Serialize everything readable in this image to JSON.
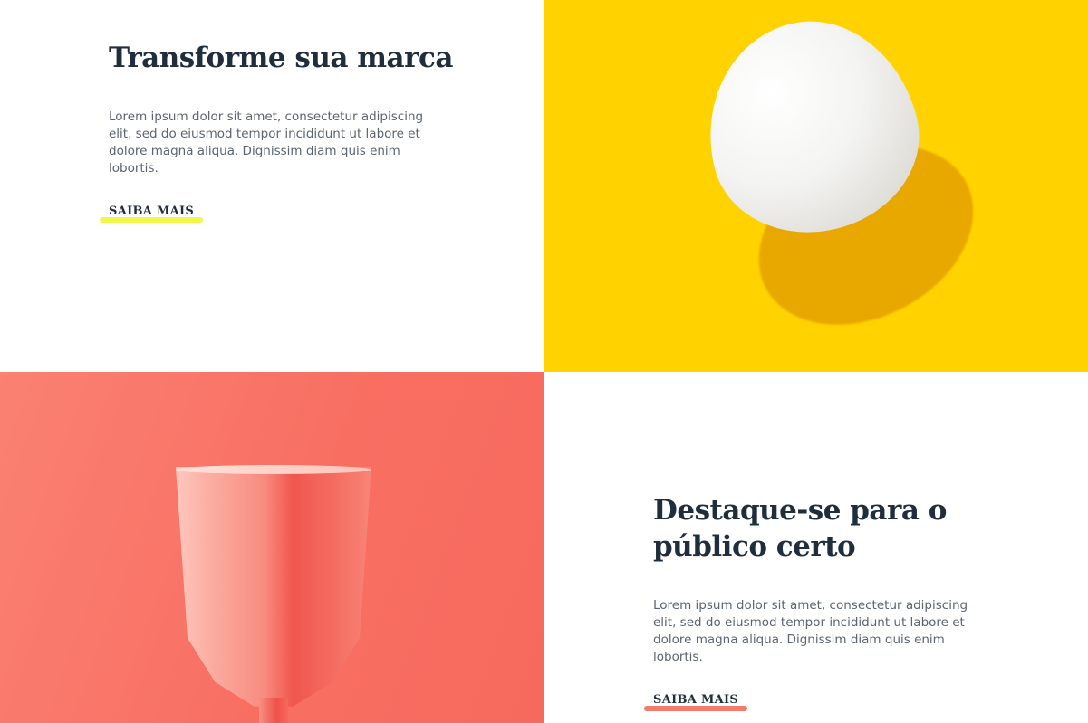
{
  "section_1": {
    "heading": "Transforme sua marca",
    "body": "Lorem ipsum dolor sit amet, consectetur adipiscing elit, sed do eiusmod tempor incididunt ut labore et dolore magna aliqua. Dignissim diam quis enim lobortis.",
    "cta_label": "SAIBA MAIS",
    "cta_underline_color": "#f4f64a",
    "image": {
      "subject": "egg-image",
      "background_color": "#ffd200"
    }
  },
  "section_2": {
    "heading": "Destaque-se para o público certo",
    "body": "Lorem ipsum dolor sit amet, consectetur adipiscing elit, sed do eiusmod tempor incididunt ut labore et dolore magna aliqua. Dignissim diam quis enim lobortis.",
    "cta_label": "SAIBA MAIS",
    "cta_underline_color": "#f47a6e",
    "image": {
      "subject": "cup-image",
      "background_color": "#f86f62"
    }
  },
  "colors": {
    "heading": "#1f2d3d",
    "body_text": "#5b6470"
  }
}
